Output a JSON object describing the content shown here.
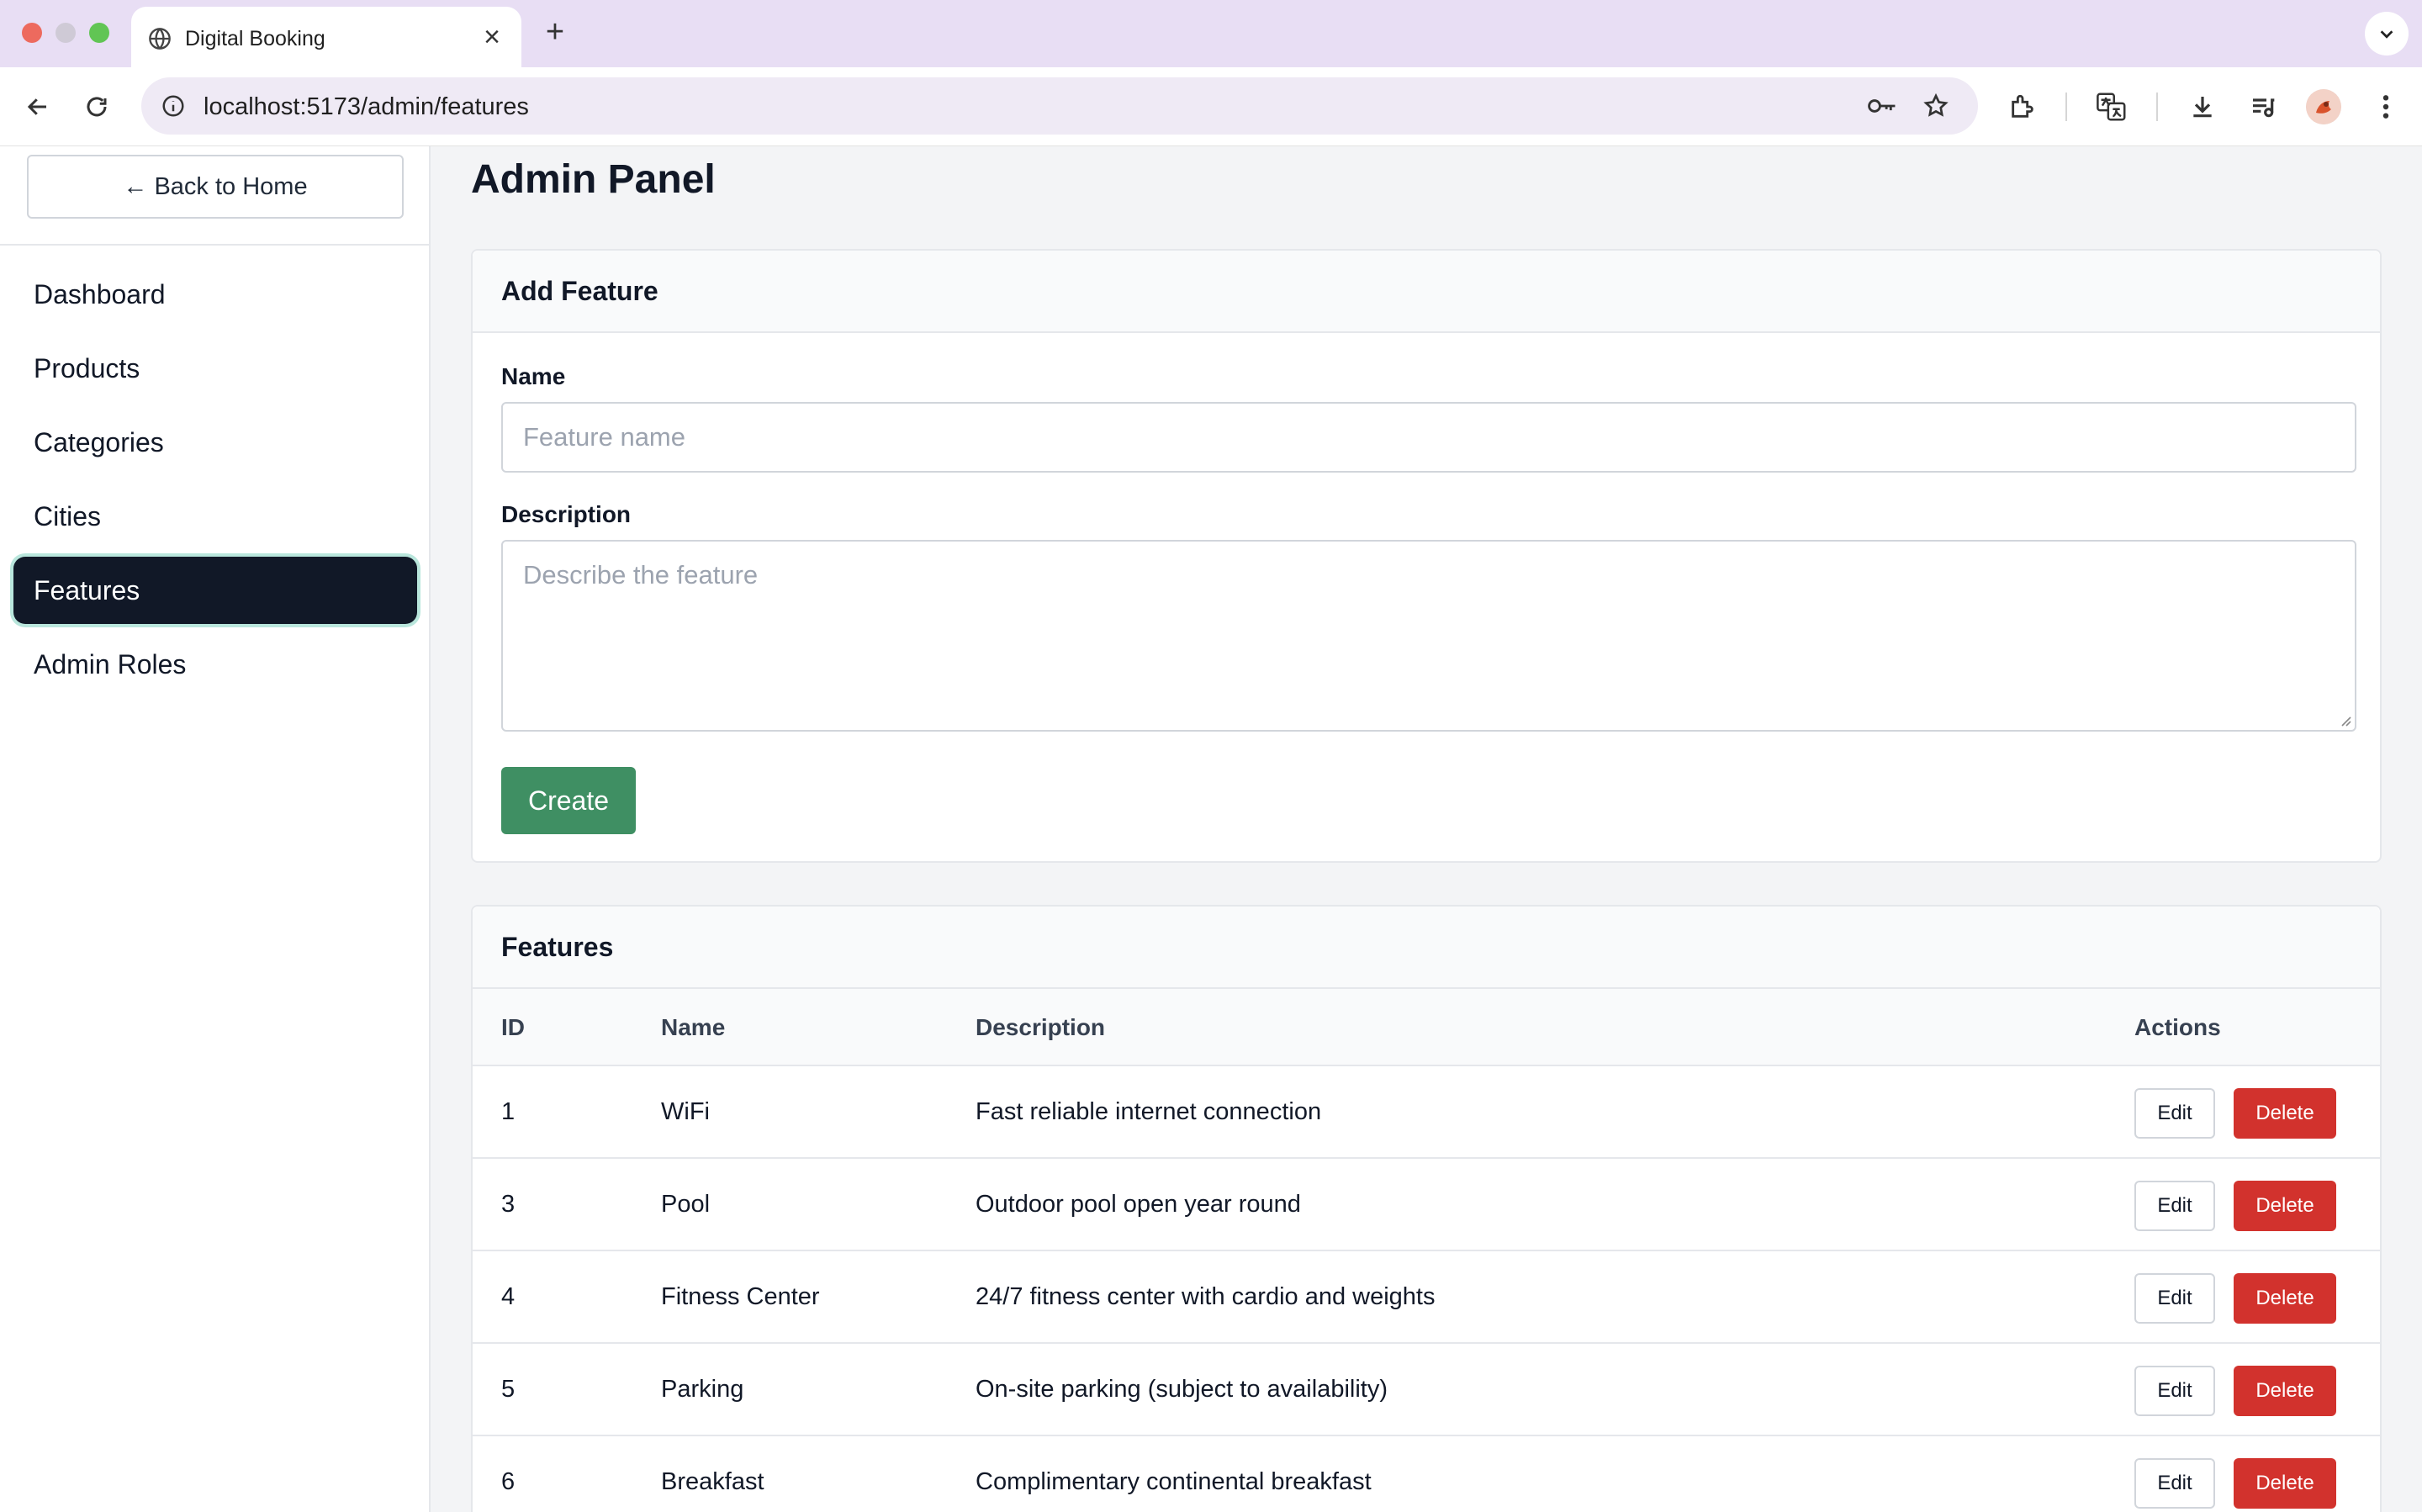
{
  "browser": {
    "tab_title": "Digital Booking",
    "url_host": "localhost",
    "url_rest": ":5173/admin/features",
    "new_tab_symbol": "+",
    "tab_close_symbol": "×"
  },
  "sidebar": {
    "back_label": "← Back to Home",
    "items": [
      {
        "label": "Dashboard",
        "active": false
      },
      {
        "label": "Products",
        "active": false
      },
      {
        "label": "Categories",
        "active": false
      },
      {
        "label": "Cities",
        "active": false
      },
      {
        "label": "Features",
        "active": true
      },
      {
        "label": "Admin Roles",
        "active": false
      }
    ]
  },
  "page": {
    "title": "Admin Panel"
  },
  "add_feature": {
    "heading": "Add Feature",
    "name_label": "Name",
    "name_placeholder": "Feature name",
    "name_value": "",
    "description_label": "Description",
    "description_placeholder": "Describe the feature",
    "description_value": "",
    "create_label": "Create"
  },
  "features_table": {
    "heading": "Features",
    "columns": [
      "ID",
      "Name",
      "Description",
      "Actions"
    ],
    "edit_label": "Edit",
    "delete_label": "Delete",
    "rows": [
      {
        "id": "1",
        "name": "WiFi",
        "description": "Fast reliable internet connection"
      },
      {
        "id": "3",
        "name": "Pool",
        "description": "Outdoor pool open year round"
      },
      {
        "id": "4",
        "name": "Fitness Center",
        "description": "24/7 fitness center with cardio and weights"
      },
      {
        "id": "5",
        "name": "Parking",
        "description": "On-site parking (subject to availability)"
      },
      {
        "id": "6",
        "name": "Breakfast",
        "description": "Complimentary continental breakfast"
      }
    ]
  },
  "colors": {
    "active_nav": "#111827",
    "create_button": "#3f8f63",
    "delete_button": "#d2322d",
    "tab_strip": "#e8def4"
  }
}
